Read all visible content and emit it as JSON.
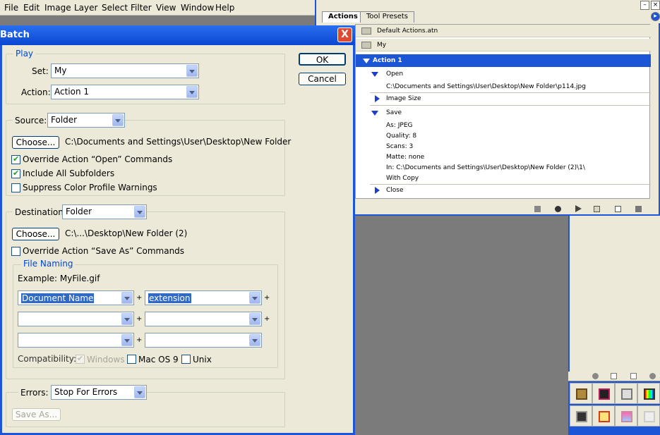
{
  "menubar": {
    "items": [
      "File",
      "Edit",
      "Image",
      "Layer",
      "Select",
      "Filter",
      "View",
      "Window",
      "Help"
    ]
  },
  "actions_panel": {
    "tabs": [
      "Actions",
      "Tool Presets"
    ],
    "sets": [
      "Default Actions.atn",
      "My"
    ],
    "selected_action": "Action 1",
    "steps": [
      {
        "label": "Open",
        "details": [
          "C:\\Documents and Settings\\User\\Desktop\\New Folder\\p114.jpg"
        ]
      },
      {
        "label": "Image Size",
        "details": []
      },
      {
        "label": "Save",
        "details": [
          "As: JPEG",
          "Quality: 8",
          "Scans: 3",
          "Matte: none",
          "In: C:\\Documents and Settings\\User\\Desktop\\New Folder (2)\\1\\",
          "With Copy"
        ]
      },
      {
        "label": "Close",
        "details": []
      }
    ]
  },
  "dialog": {
    "title": "Batch",
    "close": "X",
    "play": {
      "legend": "Play",
      "set_label": "Set:",
      "set_value": "My",
      "action_label": "Action:",
      "action_value": "Action 1"
    },
    "ok": "OK",
    "cancel": "Cancel",
    "source": {
      "label": "Source:",
      "value": "Folder",
      "choose": "Choose...",
      "path": "C:\\Documents and Settings\\User\\Desktop\\New Folder",
      "override_open": "Override Action “Open” Commands",
      "include_subfolders": "Include All Subfolders",
      "suppress_warnings": "Suppress Color Profile Warnings"
    },
    "destination": {
      "label": "Destination:",
      "value": "Folder",
      "choose": "Choose...",
      "path": "C:\\...\\Desktop\\New Folder (2)",
      "override_save": "Override Action “Save As” Commands"
    },
    "file_naming": {
      "legend": "File Naming",
      "example": "Example: MyFile.gif",
      "field1": "Document Name",
      "field2": "extension",
      "plus": "+",
      "compat_label": "Compatibility:",
      "windows": "Windows",
      "macos9": "Mac OS 9",
      "unix": "Unix"
    },
    "errors": {
      "label": "Errors:",
      "value": "Stop For Errors",
      "save_as": "Save As..."
    }
  }
}
